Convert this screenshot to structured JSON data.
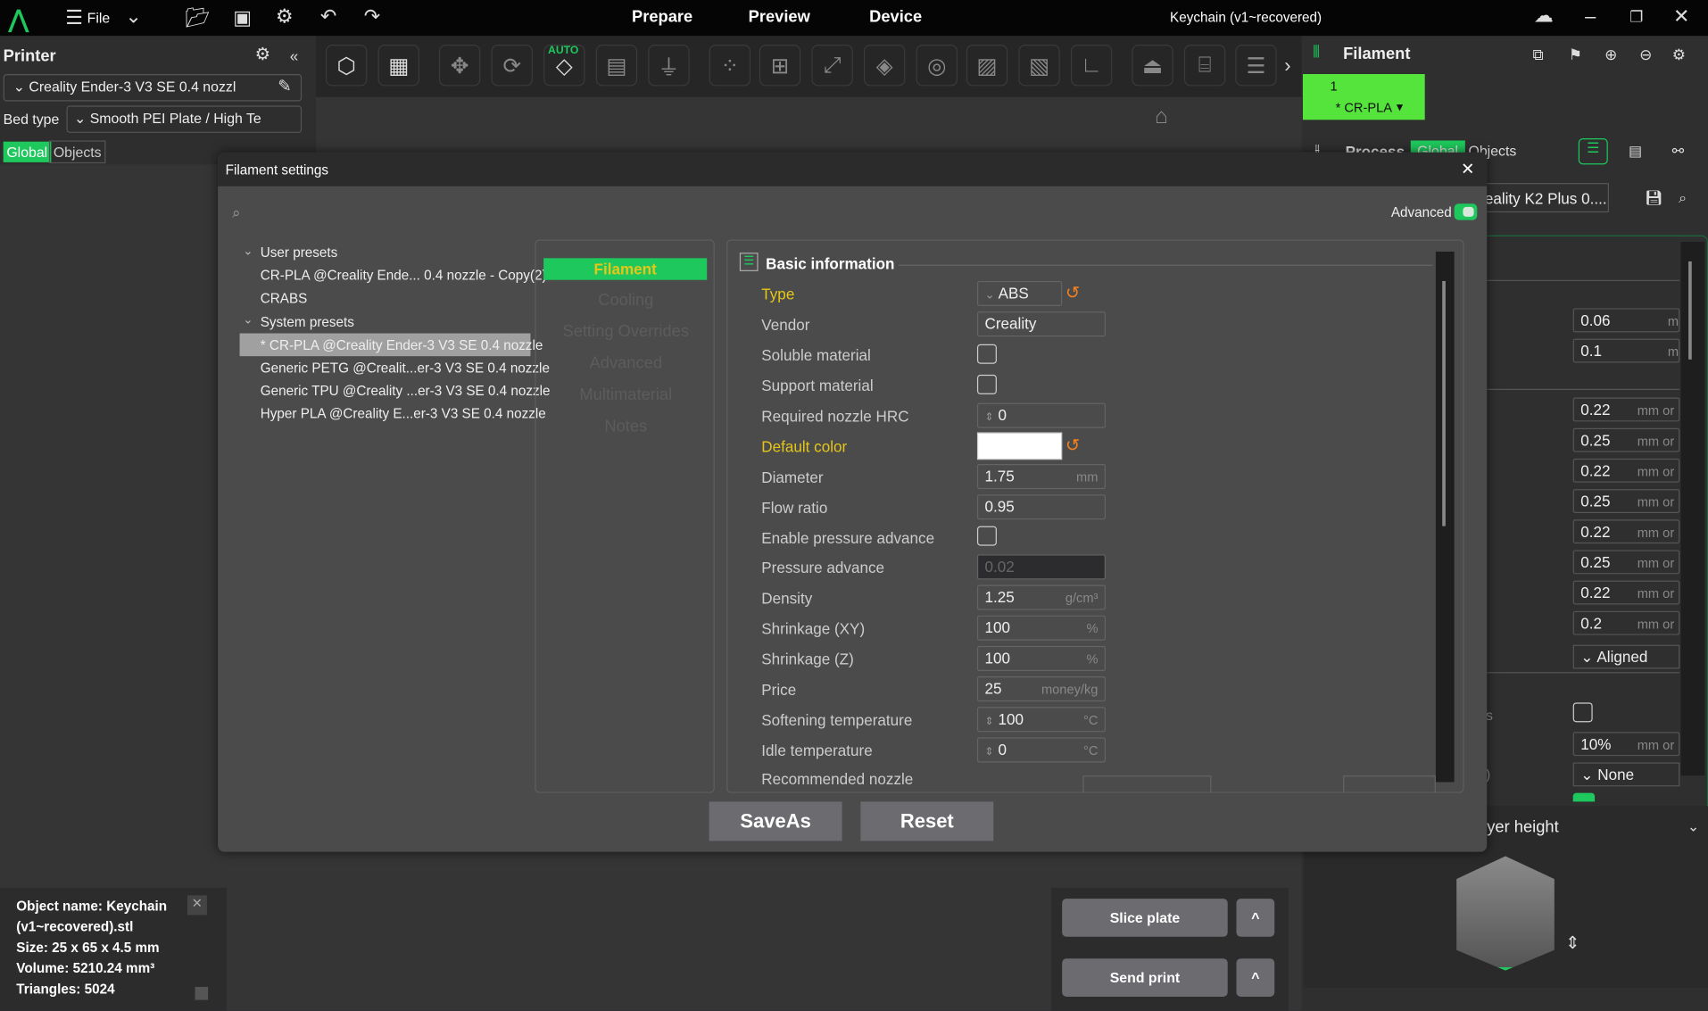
{
  "titlebar": {
    "menu_label": "File",
    "tabs": [
      "Prepare",
      "Preview",
      "Device"
    ],
    "project_title": "Keychain (v1~recovered)"
  },
  "printer_panel": {
    "title": "Printer",
    "printer_name": "Creality Ender-3 V3 SE 0.4 nozzl",
    "bed_type_label": "Bed type",
    "bed_type_value": "Smooth PEI Plate / High Te",
    "tab_global": "Global",
    "tab_objects": "Objects"
  },
  "toolbar": {
    "auto_label": "AUTO",
    "icons": [
      "add-object-icon",
      "add-plate-icon",
      "move-icon",
      "rotate-icon",
      "auto-orient-icon",
      "arrange-icon",
      "lay-on-face-icon",
      "split-objects-icon",
      "split-parts-icon",
      "scale-icon",
      "cut-icon",
      "hollow-icon",
      "variable-layer-icon",
      "support-paint-icon",
      "measure-icon",
      "seam-paint-icon",
      "text-icon",
      "layers-icon"
    ]
  },
  "filament_panel": {
    "title": "Filament",
    "slot_number": "1",
    "slot_name": "* CR-PLA",
    "slot_color": "#54e43c"
  },
  "process_panel": {
    "title": "Process",
    "tab_global": "Global",
    "tab_objects": "Objects",
    "preset": "eality K2 Plus 0....",
    "values": [
      "0.06",
      "0.1",
      "0.22",
      "0.25",
      "0.22",
      "0.25",
      "0.22",
      "0.25",
      "0.22",
      "0.2"
    ],
    "units": [
      "m",
      "m",
      "mm or",
      "mm or",
      "mm or",
      "mm or",
      "mm or",
      "mm or",
      "mm or",
      "mm or"
    ],
    "seam": "Aligned",
    "partial_label": "s",
    "percent": "10%",
    "percent_unit": "mm or",
    "ironing": "None",
    "paren": ")"
  },
  "layer_panel": {
    "label": "yer height"
  },
  "object_info": {
    "name": "Object name: Keychain",
    "file": "(v1~recovered).stl",
    "size": "Size: 25 x 65 x 4.5 mm",
    "volume": "Volume: 5210.24 mm³",
    "triangles": "Triangles: 5024"
  },
  "slice": {
    "slice_label": "Slice plate",
    "send_label": "Send print",
    "caret": "^"
  },
  "dialog": {
    "title": "Filament settings",
    "advanced_label": "Advanced",
    "advanced_on": true,
    "tree": {
      "user_header": "User presets",
      "user": [
        "CR-PLA @Creality Ende... 0.4 nozzle - Copy(2)",
        "CRABS"
      ],
      "system_header": "System presets",
      "system": [
        "* CR-PLA @Creality Ender-3 V3 SE 0.4 nozzle",
        "Generic PETG @Crealit...er-3 V3 SE 0.4 nozzle",
        "Generic TPU @Creality ...er-3 V3 SE 0.4 nozzle",
        "Hyper PLA @Creality E...er-3 V3 SE 0.4 nozzle"
      ],
      "selected": "* CR-PLA @Creality Ender-3 V3 SE 0.4 nozzle"
    },
    "nav": [
      "Filament",
      "Cooling",
      "Setting Overrides",
      "Advanced",
      "Multimaterial",
      "Notes"
    ],
    "section_title": "Basic information",
    "fields": {
      "type": {
        "label": "Type",
        "value": "ABS"
      },
      "vendor": {
        "label": "Vendor",
        "value": "Creality"
      },
      "soluble": {
        "label": "Soluble material",
        "checked": false
      },
      "support": {
        "label": "Support material",
        "checked": false
      },
      "hrc": {
        "label": "Required nozzle HRC",
        "value": "0"
      },
      "color": {
        "label": "Default color",
        "value": "#ffffff"
      },
      "diameter": {
        "label": "Diameter",
        "value": "1.75",
        "unit": "mm"
      },
      "flow": {
        "label": "Flow ratio",
        "value": "0.95"
      },
      "pa_enable": {
        "label": "Enable pressure advance",
        "checked": false
      },
      "pa": {
        "label": "Pressure advance",
        "value": "0.02"
      },
      "density": {
        "label": "Density",
        "value": "1.25",
        "unit": "g/cm³"
      },
      "shrink_xy": {
        "label": "Shrinkage (XY)",
        "value": "100",
        "unit": "%"
      },
      "shrink_z": {
        "label": "Shrinkage (Z)",
        "value": "100",
        "unit": "%"
      },
      "price": {
        "label": "Price",
        "value": "25",
        "unit": "money/kg"
      },
      "soften": {
        "label": "Softening temperature",
        "value": "100",
        "unit": "°C"
      },
      "idle": {
        "label": "Idle temperature",
        "value": "0",
        "unit": "°C"
      },
      "nozzle": {
        "label": "Recommended nozzle"
      }
    },
    "save_as": "SaveAs",
    "reset": "Reset"
  },
  "colors": {
    "accent": "#1ec85c",
    "modified": "#e6c619",
    "reset_icon": "#f08020"
  }
}
